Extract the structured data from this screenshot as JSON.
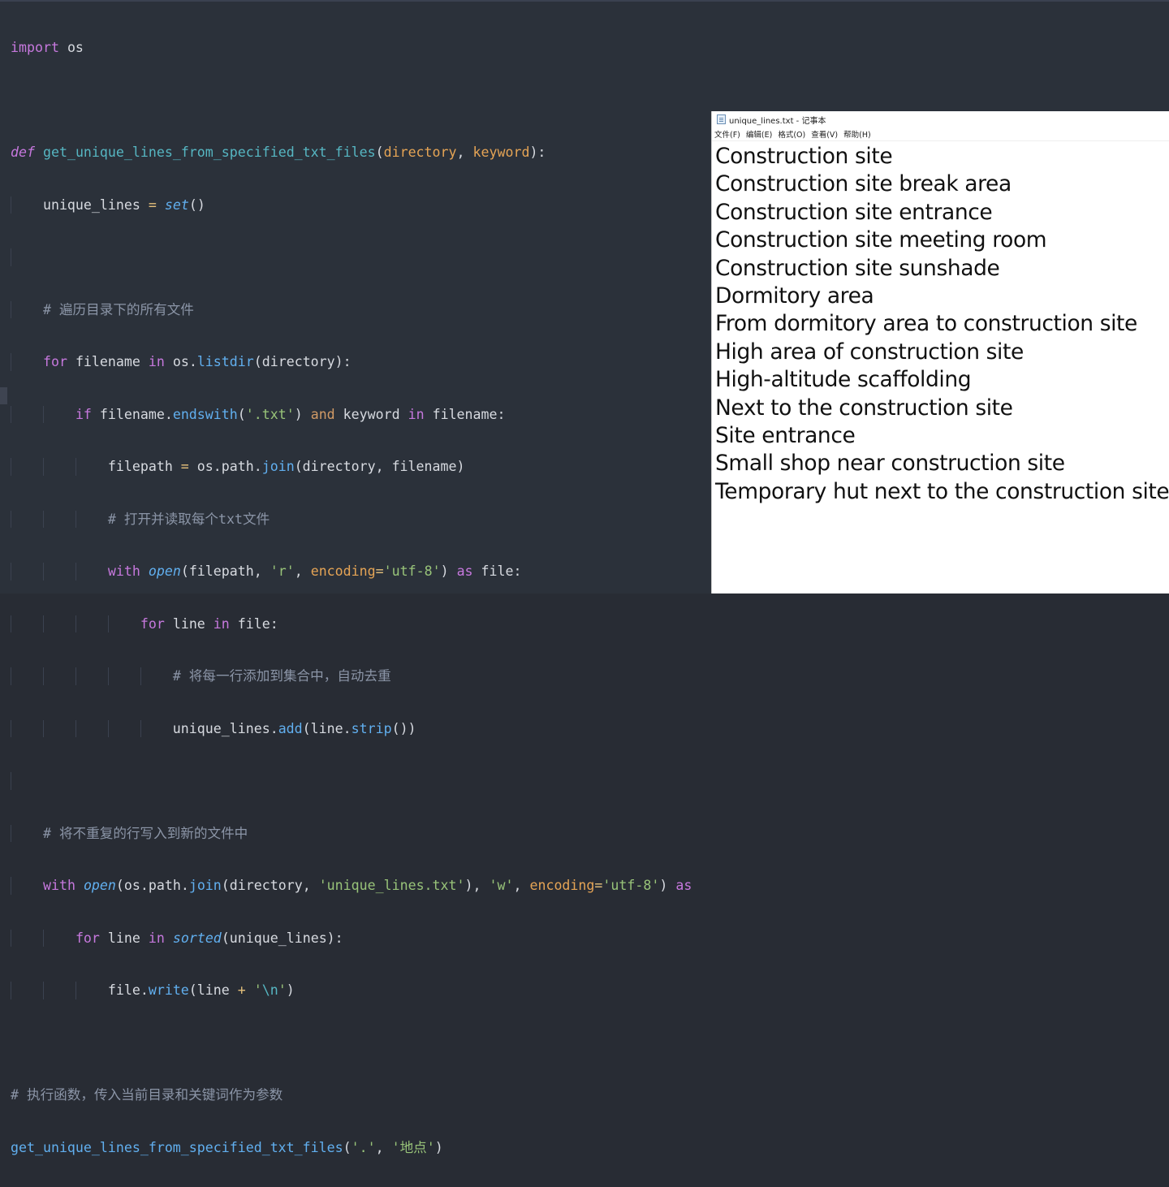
{
  "editor": {
    "lines": [
      "import os",
      "",
      "def get_unique_lines_from_specified_txt_files(directory, keyword):",
      "    unique_lines = set()",
      "",
      "    # 遍历目录下的所有文件",
      "    for filename in os.listdir(directory):",
      "        if filename.endswith('.txt') and keyword in filename:",
      "            filepath = os.path.join(directory, filename)",
      "            # 打开并读取每个txt文件",
      "            with open(filepath, 'r', encoding='utf-8') as file:",
      "                for line in file:",
      "                    # 将每一行添加到集合中，自动去重",
      "                    unique_lines.add(line.strip())",
      "",
      "    # 将不重复的行写入到新的文件中",
      "    with open(os.path.join(directory, 'unique_lines.txt'), 'w', encoding='utf-8') as",
      "        for line in sorted(unique_lines):",
      "            file.write(line + '\\n')",
      "",
      "# 执行函数，传入当前目录和关键词作为参数",
      "get_unique_lines_from_specified_txt_files('.', '地点')"
    ]
  },
  "notepad": {
    "title": "unique_lines.txt - 记事本",
    "icon": "notepad-icon",
    "menu": [
      "文件(F)",
      "编辑(E)",
      "格式(O)",
      "查看(V)",
      "帮助(H)"
    ],
    "lines": [
      "Construction site",
      "Construction site break area",
      "Construction site entrance",
      "Construction site meeting room",
      "Construction site sunshade",
      "Dormitory area",
      "From dormitory area to construction site",
      "High area of construction site",
      "High-altitude scaffolding",
      "Next to the construction site",
      "Site entrance",
      "Small shop near construction site",
      "Temporary hut next to the construction site"
    ]
  }
}
